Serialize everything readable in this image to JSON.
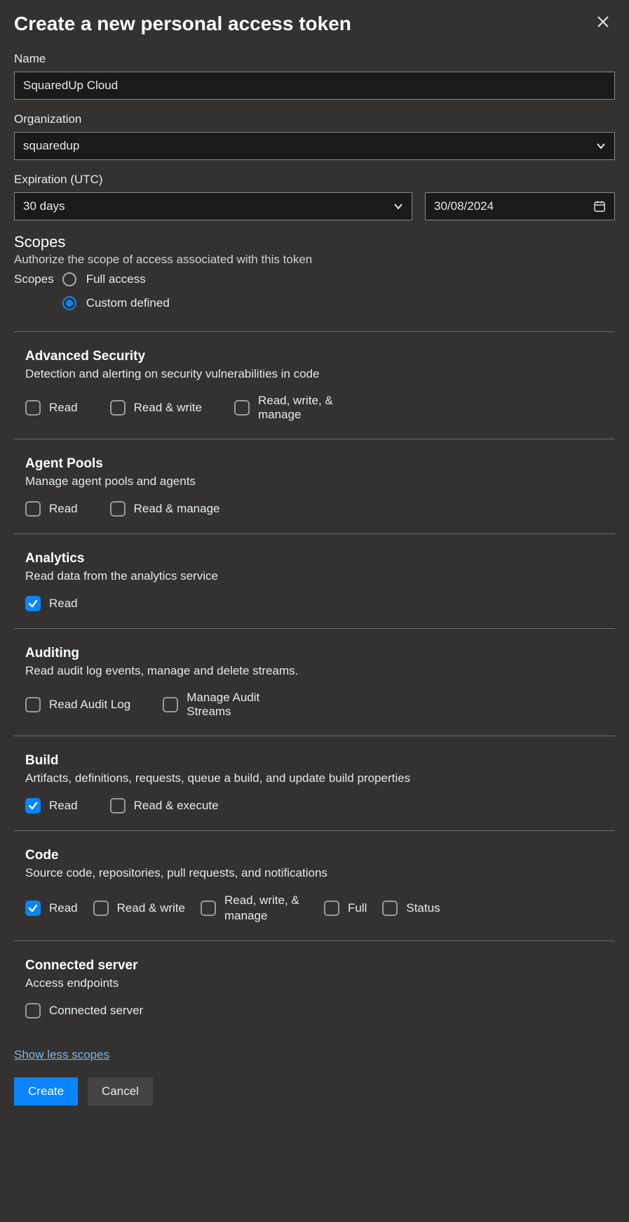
{
  "header": {
    "title": "Create a new personal access token"
  },
  "fields": {
    "name_label": "Name",
    "name_value": "SquaredUp Cloud",
    "org_label": "Organization",
    "org_value": "squaredup",
    "exp_label": "Expiration (UTC)",
    "exp_value": "30 days",
    "exp_date": "30/08/2024"
  },
  "scopes_header": {
    "title": "Scopes",
    "subtitle": "Authorize the scope of access associated with this token",
    "label": "Scopes",
    "full_access": "Full access",
    "custom_defined": "Custom defined"
  },
  "groups": [
    {
      "title": "Advanced Security",
      "desc": "Detection and alerting on security vulnerabilities in code",
      "items": [
        {
          "label": "Read",
          "checked": false
        },
        {
          "label": "Read & write",
          "checked": false
        },
        {
          "label": "Read, write, & manage",
          "checked": false
        }
      ]
    },
    {
      "title": "Agent Pools",
      "desc": "Manage agent pools and agents",
      "items": [
        {
          "label": "Read",
          "checked": false
        },
        {
          "label": "Read & manage",
          "checked": false
        }
      ]
    },
    {
      "title": "Analytics",
      "desc": "Read data from the analytics service",
      "items": [
        {
          "label": "Read",
          "checked": true
        }
      ]
    },
    {
      "title": "Auditing",
      "desc": "Read audit log events, manage and delete streams.",
      "items": [
        {
          "label": "Read Audit Log",
          "checked": false
        },
        {
          "label": "Manage Audit Streams",
          "checked": false
        }
      ]
    },
    {
      "title": "Build",
      "desc": "Artifacts, definitions, requests, queue a build, and update build properties",
      "items": [
        {
          "label": "Read",
          "checked": true
        },
        {
          "label": "Read & execute",
          "checked": false
        }
      ]
    },
    {
      "title": "Code",
      "desc": "Source code, repositories, pull requests, and notifications",
      "items": [
        {
          "label": "Read",
          "checked": true
        },
        {
          "label": "Read & write",
          "checked": false
        },
        {
          "label": "Read, write, & manage",
          "checked": false
        },
        {
          "label": "Full",
          "checked": false
        },
        {
          "label": "Status",
          "checked": false
        }
      ]
    },
    {
      "title": "Connected server",
      "desc": "Access endpoints",
      "items": [
        {
          "label": "Connected server",
          "checked": false
        }
      ]
    }
  ],
  "show_less": "Show less scopes",
  "buttons": {
    "create": "Create",
    "cancel": "Cancel"
  }
}
